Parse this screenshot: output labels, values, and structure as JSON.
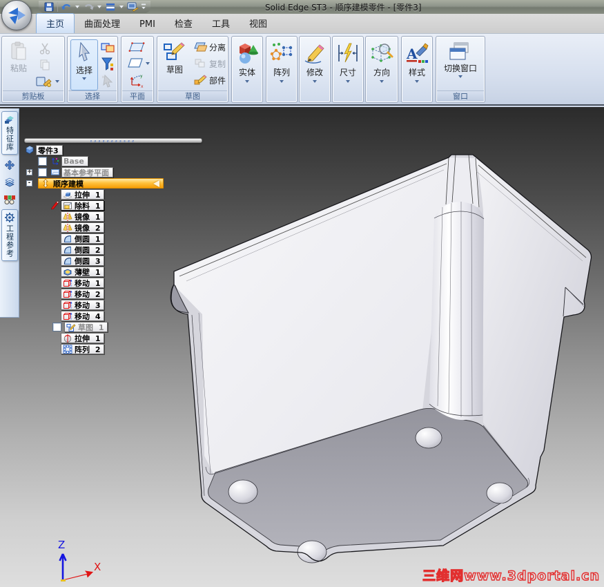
{
  "window": {
    "title": "Solid Edge ST3 - 顺序建模零件 - [零件3]"
  },
  "qat": {
    "icons": [
      "save-icon",
      "undo-icon",
      "redo-icon",
      "command-list-icon",
      "screen-style-icon",
      "qat-overflow-icon"
    ]
  },
  "tabs": [
    {
      "label": "主页",
      "active": true
    },
    {
      "label": "曲面处理",
      "active": false
    },
    {
      "label": "PMI",
      "active": false
    },
    {
      "label": "检查",
      "active": false
    },
    {
      "label": "工具",
      "active": false
    },
    {
      "label": "视图",
      "active": false
    }
  ],
  "ribbon": {
    "clipboard": {
      "caption": "剪贴板",
      "paste": "粘贴"
    },
    "select": {
      "caption": "选择",
      "button": "选择"
    },
    "plane": {
      "caption": "平面"
    },
    "sketch": {
      "caption": "草图",
      "button": "草图",
      "items": [
        "分离",
        "复制",
        "部件"
      ]
    },
    "collapsed": [
      {
        "label": "实体"
      },
      {
        "label": "阵列"
      },
      {
        "label": "修改"
      },
      {
        "label": "尺寸"
      },
      {
        "label": "方向"
      },
      {
        "label": "样式"
      }
    ],
    "window_group": {
      "caption": "窗口",
      "button": "切换窗口"
    }
  },
  "side_tabs": {
    "top": "特征库",
    "bottom": "工程参考"
  },
  "tree": {
    "items": [
      {
        "label": "零件3",
        "icon": "part",
        "type": "root"
      },
      {
        "label": "Base",
        "icon": "base-axes",
        "type": "child",
        "checkbox": true,
        "checked": false,
        "gray": true
      },
      {
        "label": "基本参考平面",
        "icon": "ref-planes",
        "type": "child",
        "checkbox": true,
        "checked": false,
        "gray": true,
        "expander": "+"
      },
      {
        "label": "顺序建模",
        "icon": "ordered",
        "type": "header",
        "expander": "-"
      },
      {
        "label": "拉伸 1",
        "icon": "extrude",
        "type": "feature"
      },
      {
        "label": "除料 1",
        "icon": "cutout",
        "type": "feature",
        "edit": true,
        "selected": true
      },
      {
        "label": "镜像 1",
        "icon": "mirror",
        "type": "feature"
      },
      {
        "label": "镜像 2",
        "icon": "mirror",
        "type": "feature"
      },
      {
        "label": "倒圆 1",
        "icon": "round",
        "type": "feature"
      },
      {
        "label": "倒圆 2",
        "icon": "round",
        "type": "feature"
      },
      {
        "label": "倒圆 3",
        "icon": "round",
        "type": "feature"
      },
      {
        "label": "薄壁 1",
        "icon": "thinwall",
        "type": "feature"
      },
      {
        "label": "移动 1",
        "icon": "move",
        "type": "feature"
      },
      {
        "label": "移动 2",
        "icon": "move",
        "type": "feature"
      },
      {
        "label": "移动 3",
        "icon": "move",
        "type": "feature"
      },
      {
        "label": "移动 4",
        "icon": "move",
        "type": "feature"
      },
      {
        "label": "草图 1",
        "icon": "sketch",
        "type": "feature",
        "checkbox": true,
        "checked": false,
        "gray": true
      },
      {
        "label": "拉伸 1",
        "icon": "revolve",
        "type": "feature"
      },
      {
        "label": "阵列 2",
        "icon": "pattern",
        "type": "feature"
      }
    ]
  },
  "axes": {
    "x": "X",
    "z": "Z"
  },
  "watermark": "三维网www.3dportal.cn",
  "colors": {
    "accent_orange": "#f59d06",
    "active_tab_blue": "#cfe0f5",
    "ribbon_blue": "#d6dfee",
    "watermark_red": "#e23030",
    "viewport_top": "#2b2b2b",
    "viewport_bottom": "#dedede"
  }
}
